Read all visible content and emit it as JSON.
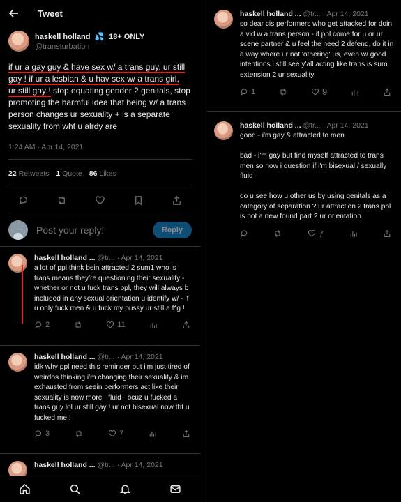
{
  "header": {
    "title": "Tweet"
  },
  "main_tweet": {
    "name": "haskell holland",
    "badge": "18+ ONLY",
    "handle": "@transturbation",
    "text_parts": {
      "u1": "if ur a gay guy & have sex w/ a trans guy, ur still",
      "u2": "gay ! if ur a lesbian & u hav sex w/ a trans girl,",
      "u3": "ur still gay !",
      "rest": " stop equating gender 2 genitals, stop promoting the harmful idea that being w/ a trans person changes ur sexuality + is a separate sexuality from wht u alrdy are"
    },
    "time": "1:24 AM · Apr 14, 2021",
    "retweets_count": "22",
    "retweets_label": "Retweets",
    "quotes_count": "1",
    "quotes_label": "Quote",
    "likes_count": "86",
    "likes_label": "Likes"
  },
  "reply_box": {
    "placeholder": "Post your reply!",
    "button": "Reply"
  },
  "left_replies": [
    {
      "name": "haskell holland ...",
      "handle": "@tr...",
      "date": "· Apr 14, 2021",
      "text": "a lot of ppl think bein attracted 2 sum1 who is trans means they're questioning their sexuality - whether or not u fuck trans ppl, they will always b included in any sexual orientation u identify w/ - if u only fuck men & u fuck my pussy ur still a f*g !",
      "replies": "2",
      "retweets": "",
      "likes": "11"
    },
    {
      "name": "haskell holland ...",
      "handle": "@tr...",
      "date": "· Apr 14, 2021",
      "text": "idk why ppl need this reminder but i'm just tired of weirdos thinking i'm changing their sexuality & im exhausted from seein performers act like their sexuality is now more ~fluid~ bcuz u fucked a trans guy lol ur still gay ! ur not bisexual now tht u fucked me !",
      "replies": "3",
      "retweets": "",
      "likes": "7"
    },
    {
      "name": "haskell holland ...",
      "handle": "@tr...",
      "date": "· Apr 14, 2021"
    }
  ],
  "right_replies": [
    {
      "name": "haskell holland ...",
      "handle": "@tr...",
      "date": "· Apr 14, 2021",
      "text": "so dear cis performers who get attacked for doin a vid w a trans person - if ppl come for u or ur scene partner & u feel the need 2 defend, do it in a way where ur not 'othering' us, even w/ good intentions i still see y'all acting like trans is sum extension 2 ur sexuality",
      "replies": "1",
      "retweets": "",
      "likes": "9"
    },
    {
      "name": "haskell holland ...",
      "handle": "@tr...",
      "date": "· Apr 14, 2021",
      "text": "good - i'm gay & attracted to men\n\nbad - i'm gay but find myself attracted to trans men so now i question if i'm bisexual / sexually fluid\n\ndo u see how u other us by using genitals as a category of separation ? ur attraction 2 trans ppl is not a new found part 2 ur orientation",
      "replies": "",
      "retweets": "",
      "likes": "7"
    }
  ],
  "icons": [
    "back-arrow-icon",
    "verified-icon",
    "reply-icon",
    "retweet-icon",
    "like-icon",
    "bookmark-icon",
    "share-icon",
    "views-icon",
    "home-icon",
    "search-icon",
    "notifications-icon",
    "messages-icon"
  ]
}
